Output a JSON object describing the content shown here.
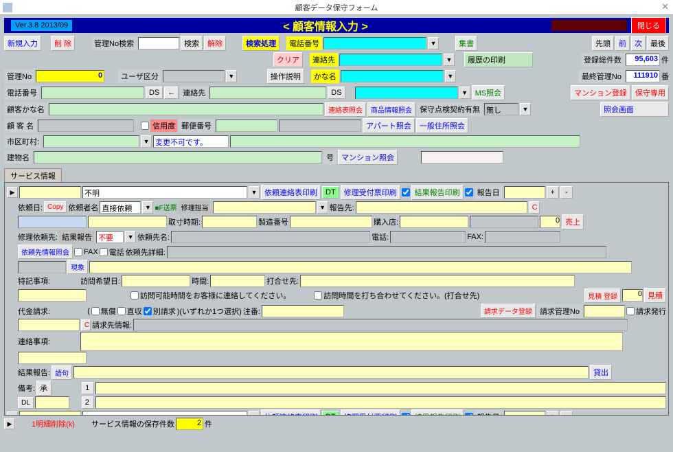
{
  "window": {
    "title": "顧客データ保守フォーム"
  },
  "header": {
    "version": "Ver.3.8  2013/09",
    "title": "<          顧客情報入力  >",
    "close": "閉じる"
  },
  "toolbar": {
    "newEntry": "新規入力",
    "delete": "削 除",
    "mgmtSearch": "管理No検索",
    "search": "検索",
    "release": "解除",
    "searchProc": "検索処理",
    "clear": "クリア",
    "phone": "電話番号",
    "contact": "連絡先",
    "kana": "かな名",
    "opGuide": "操作説明",
    "collect": "集書",
    "printHist": "履歴の印刷",
    "first": "先頭",
    "prev": "前",
    "next": "次",
    "last": "最後",
    "regCount": "登録総件数",
    "regCountVal": "95,603",
    "regUnit": "件",
    "lastMgmt": "最終管理No",
    "lastMgmtVal": "111910",
    "lastUnit": "番"
  },
  "cust": {
    "mgmtNo": "管理No",
    "mgmtNoVal": "0",
    "userDiv": "ユーザ区分",
    "phone": "電話番号",
    "ds": "DS",
    "arrow": "←",
    "contact": "連絡先",
    "msRef": "MS照会",
    "mansionReg": "マンション登録",
    "maintOnly": "保守専用",
    "kana": "顧客かな名",
    "contactRef": "連絡表照会",
    "prodRef": "商品情報照会",
    "maintContract": "保守点検契約有無",
    "none": "無し",
    "refScreen": "照会画面",
    "name": "顧 客 名",
    "credit": "信用度",
    "postal": "郵便番号",
    "aptRef": "アパート照会",
    "addrRef": "一般住所照会",
    "city": "市区町村:",
    "noChange": "変更不可です。",
    "bldg": "建物名",
    "unit": "号",
    "mansionRef": "マンション照会"
  },
  "svc": {
    "tab": "サービス情報",
    "unknown": "不明",
    "reqPrint": "依頼連絡表印刷",
    "dt": "DT",
    "repairPrint": "修理受付票印刷",
    "resultPrint": "結果報告印刷",
    "reportDate": "報告日",
    "reqDate": "依頼日:",
    "copy": "Copy",
    "reqName": "依頼者名",
    "direct": "直接依頼",
    "fsend": "■F送票",
    "repairPerson": "修理担当",
    "reportTo": "報告先:",
    "c": "C",
    "acqTime": "取寸時期:",
    "mfgNo": "製造番号",
    "purchase": "購入店:",
    "zero": "0",
    "sales": "売上",
    "repairReq": "修理依頼先:",
    "result": "結果報告",
    "notReq": "不要",
    "reqName2": "依頼先名:",
    "tel": "電話:",
    "fax": "FAX:",
    "reqInfoRef": "依頼先情報照会",
    "faxChk": "FAX",
    "telChk": "電話",
    "reqDetail": "依頼先詳細:",
    "cash": "現象",
    "note": "特記事項:",
    "visitDate": "訪問希望日:",
    "time": "時間:",
    "meetAt": "打合せ先:",
    "msg1": "訪問可能時間をお客様に連絡してください。",
    "msg2": "訪問時間を打ち合わせてください。(打合せ先)",
    "estReg": "見積 登録",
    "est": "見積",
    "payment": "代金請求:",
    "free": "無償",
    "direct2": "直収",
    "separate": "別請求",
    "choose": ")(いずれか1つ選択)",
    "caution": "注番:",
    "billData": "請求データ登録",
    "billMgmt": "請求管理No",
    "billIssue": "請求発行",
    "contactNote": "連絡事項:",
    "billInfo": "請求先情報:",
    "resultRep": "結果報告:",
    "phrase": "語句",
    "lend": "貸出",
    "remarks": "備考:",
    "approve": "承",
    "one": "1",
    "two": "2",
    "dl": "DL",
    "delDetail": "1明細削除(k)",
    "saveCount": "サービス情報の保存件数",
    "saveVal": "2",
    "saveUnit": "件"
  }
}
